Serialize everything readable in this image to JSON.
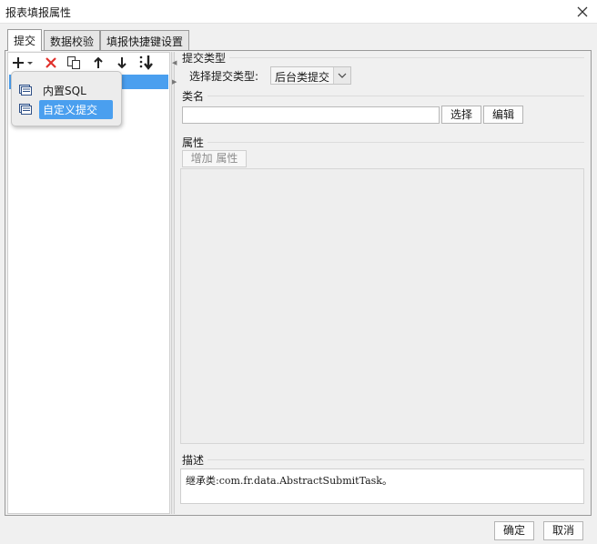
{
  "window": {
    "title": "报表填报属性",
    "close_icon": "close-icon"
  },
  "tabs": [
    {
      "label": "提交",
      "active": true
    },
    {
      "label": "数据校验",
      "active": false
    },
    {
      "label": "填报快捷键设置",
      "active": false
    }
  ],
  "toolbar": {
    "add_icon": "plus-dropdown-icon",
    "delete_icon": "delete-x-icon",
    "copy_icon": "copy-icon",
    "up_icon": "arrow-up-icon",
    "down_icon": "arrow-down-icon",
    "sort_icon": "sort-down-icon"
  },
  "add_menu": {
    "items": [
      {
        "label": "内置SQL",
        "icon": "database-icon",
        "highlighted": false
      },
      {
        "label": "自定义提交",
        "icon": "database-icon",
        "highlighted": true
      }
    ]
  },
  "submit_type": {
    "section_label": "提交类型",
    "field_label": "选择提交类型:",
    "selected": "后台类提交"
  },
  "class_name": {
    "section_label": "类名",
    "value": "",
    "select_label": "选择",
    "edit_label": "编辑"
  },
  "properties": {
    "section_label": "属性",
    "add_label": "增加 属性"
  },
  "description": {
    "section_label": "描述",
    "text": "继承类:com.fr.data.AbstractSubmitTask。"
  },
  "footer": {
    "ok_label": "确定",
    "cancel_label": "取消"
  },
  "colors": {
    "selection": "#4a9fef",
    "delete_red": "#e0302b"
  }
}
